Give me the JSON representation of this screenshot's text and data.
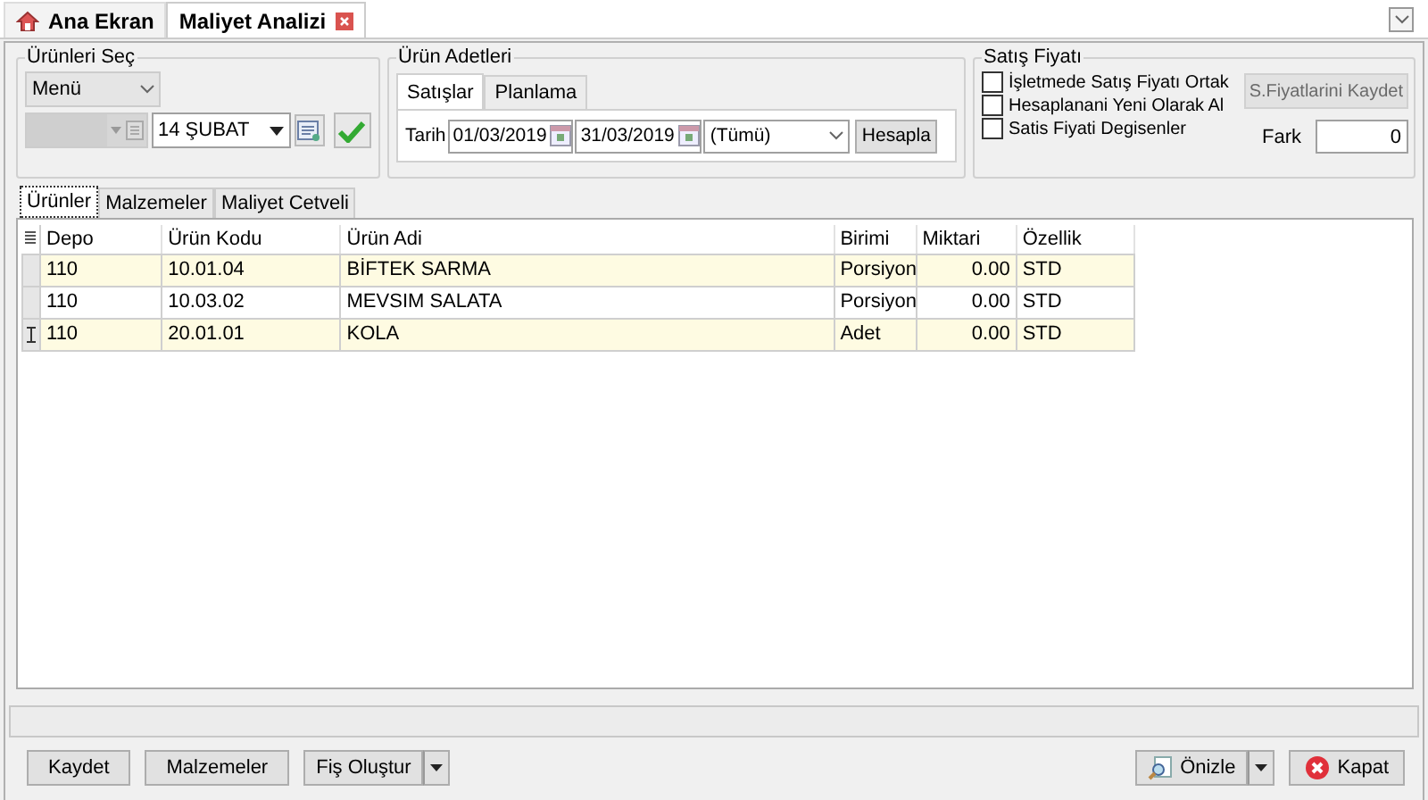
{
  "tabs": [
    {
      "label": "Ana Ekran",
      "selected": false,
      "kind": "home"
    },
    {
      "label": "Maliyet Analizi",
      "selected": true,
      "kind": "closable"
    }
  ],
  "products_group": {
    "title": "Ürünleri Seç",
    "menu": "Menü",
    "branch_select": {
      "disabled": true
    },
    "period": "14 ŞUBAT"
  },
  "quantities_group": {
    "title": "Ürün Adetleri",
    "tabs": [
      {
        "label": "Satışlar",
        "selected": true
      },
      {
        "label": "Planlama",
        "selected": false
      }
    ],
    "date_label": "Tarih",
    "date_from": "01/03/2019",
    "date_to": "31/03/2019",
    "scope": "(Tümü)",
    "calculate_button": "Hesapla"
  },
  "price_group": {
    "title": "Satış Fiyatı",
    "checkboxes": [
      {
        "label": "İşletmede Satış Fiyatı Ortak",
        "checked": false
      },
      {
        "label": "Hesaplanani Yeni Olarak Al",
        "checked": false
      },
      {
        "label": "Satis Fiyati Degisenler",
        "checked": false
      }
    ],
    "save_button": {
      "label": "S.Fiyatlarini Kaydet",
      "disabled": true
    },
    "difference_label": "Fark",
    "difference_value": "0"
  },
  "sub_tabs": [
    {
      "label": "Ürünler",
      "selected": true
    },
    {
      "label": "Malzemeler",
      "selected": false
    },
    {
      "label": "Maliyet Cetveli",
      "selected": false
    }
  ],
  "table": {
    "columns": [
      "Depo",
      "Ürün Kodu",
      "Ürün Adi",
      "Birimi",
      "Miktari",
      "Özellik"
    ],
    "rows": [
      {
        "cells": [
          "110",
          "10.01.04",
          "BİFTEK SARMA",
          "Porsiyon",
          "0.00",
          "STD"
        ],
        "current": false
      },
      {
        "cells": [
          "110",
          "10.03.02",
          "MEVSIM SALATA",
          "Porsiyon",
          "0.00",
          "STD"
        ],
        "current": false
      },
      {
        "cells": [
          "110",
          "20.01.01",
          "KOLA",
          "Adet",
          "0.00",
          "STD"
        ],
        "current": true
      }
    ]
  },
  "footer_left": [
    {
      "label": "Kaydet",
      "kind": "plain"
    },
    {
      "label": "Malzemeler",
      "kind": "plain"
    },
    {
      "label": "Fiş Oluştur",
      "kind": "split"
    }
  ],
  "footer_right": [
    {
      "label": "Önizle",
      "kind": "preview"
    },
    {
      "label": "Kapat",
      "kind": "close"
    }
  ]
}
